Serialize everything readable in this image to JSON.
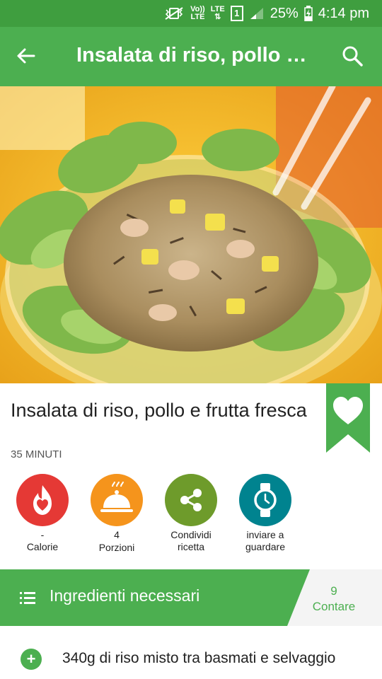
{
  "status_bar": {
    "volte": "Vo))\nLTE",
    "lte": "LTE",
    "sim": "1",
    "battery": "25%",
    "time": "4:14 pm"
  },
  "header": {
    "title": "Insalata di riso, pollo e...",
    "back_icon": "arrow-back-icon",
    "search_icon": "search-icon"
  },
  "recipe": {
    "title": "Insalata di riso, pollo e frutta fresca",
    "time": "35 MINUTI"
  },
  "actions": [
    {
      "value": "-",
      "label": "Calorie",
      "color": "#e53935",
      "icon": "calorie-flame-icon"
    },
    {
      "value": "4",
      "label": "Porzioni",
      "color": "#f5941c",
      "icon": "serving-cloche-icon"
    },
    {
      "value": "",
      "label": "Condividi\nricetta",
      "color": "#6e9b2b",
      "icon": "share-icon"
    },
    {
      "value": "",
      "label": "inviare a\nguardare",
      "color": "#00838f",
      "icon": "watch-icon"
    }
  ],
  "ingredients": {
    "title": "Ingredienti necessari",
    "count": "9",
    "count_label": "Contare",
    "items": [
      "340g di riso misto tra basmati e selvaggio"
    ]
  },
  "colors": {
    "primary": "#4caf50",
    "status_bar": "#3f9e3f"
  }
}
